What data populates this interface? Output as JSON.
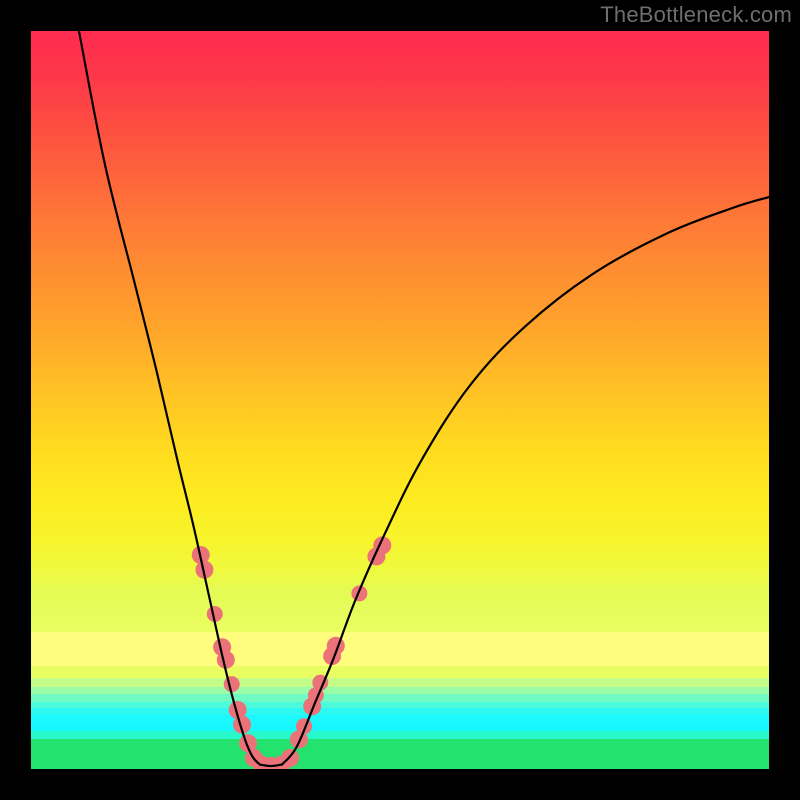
{
  "watermark": "TheBottleneck.com",
  "chart_data": {
    "type": "line",
    "title": "",
    "xlabel": "",
    "ylabel": "",
    "xlim": [
      0,
      100
    ],
    "ylim": [
      0,
      100
    ],
    "watermark": "TheBottleneck.com",
    "background_gradient": {
      "orientation": "vertical",
      "stops": [
        {
          "pos": 0,
          "color": "#fe2b4f"
        },
        {
          "pos": 50,
          "color": "#ffc724"
        },
        {
          "pos": 82,
          "color": "#fffd7d"
        },
        {
          "pos": 92,
          "color": "#1bf8fe"
        },
        {
          "pos": 100,
          "color": "#23e36e"
        }
      ]
    },
    "series": [
      {
        "name": "left-branch",
        "color": "#000000",
        "points": [
          {
            "x": 6.5,
            "y": 100
          },
          {
            "x": 10.0,
            "y": 82
          },
          {
            "x": 14.0,
            "y": 66
          },
          {
            "x": 17.0,
            "y": 54
          },
          {
            "x": 19.8,
            "y": 42
          },
          {
            "x": 22.0,
            "y": 33
          },
          {
            "x": 24.0,
            "y": 24
          },
          {
            "x": 26.0,
            "y": 15
          },
          {
            "x": 27.5,
            "y": 9
          },
          {
            "x": 29.0,
            "y": 4
          },
          {
            "x": 30.0,
            "y": 1.7
          },
          {
            "x": 31.0,
            "y": 0.6
          }
        ]
      },
      {
        "name": "right-branch",
        "color": "#000000",
        "points": [
          {
            "x": 34.0,
            "y": 0.6
          },
          {
            "x": 36.0,
            "y": 3
          },
          {
            "x": 38.5,
            "y": 9
          },
          {
            "x": 41.0,
            "y": 15
          },
          {
            "x": 44.0,
            "y": 23
          },
          {
            "x": 48.0,
            "y": 32
          },
          {
            "x": 53.0,
            "y": 42
          },
          {
            "x": 59.5,
            "y": 52
          },
          {
            "x": 67.0,
            "y": 60
          },
          {
            "x": 76.0,
            "y": 67
          },
          {
            "x": 86.0,
            "y": 72.5
          },
          {
            "x": 95.0,
            "y": 76
          },
          {
            "x": 100.0,
            "y": 77.5
          }
        ]
      },
      {
        "name": "valley-floor",
        "color": "#000000",
        "points": [
          {
            "x": 31.0,
            "y": 0.6
          },
          {
            "x": 32.5,
            "y": 0.4
          },
          {
            "x": 34.0,
            "y": 0.6
          }
        ]
      }
    ],
    "markers": {
      "color": "#ec7279",
      "radius_px": 9,
      "points": [
        {
          "x": 23.0,
          "y": 29.0,
          "r": 9
        },
        {
          "x": 23.5,
          "y": 27.0,
          "r": 9
        },
        {
          "x": 24.9,
          "y": 21.0,
          "r": 8
        },
        {
          "x": 25.9,
          "y": 16.5,
          "r": 9
        },
        {
          "x": 26.4,
          "y": 14.8,
          "r": 9
        },
        {
          "x": 27.2,
          "y": 11.5,
          "r": 8
        },
        {
          "x": 28.0,
          "y": 8.0,
          "r": 9
        },
        {
          "x": 28.6,
          "y": 6.0,
          "r": 9
        },
        {
          "x": 29.4,
          "y": 3.5,
          "r": 9
        },
        {
          "x": 30.2,
          "y": 1.5,
          "r": 9
        },
        {
          "x": 31.3,
          "y": 0.6,
          "r": 9
        },
        {
          "x": 32.6,
          "y": 0.4,
          "r": 9
        },
        {
          "x": 33.9,
          "y": 0.6,
          "r": 9
        },
        {
          "x": 35.1,
          "y": 1.5,
          "r": 9
        },
        {
          "x": 36.3,
          "y": 4.0,
          "r": 9
        },
        {
          "x": 37.0,
          "y": 5.8,
          "r": 8
        },
        {
          "x": 38.1,
          "y": 8.5,
          "r": 9
        },
        {
          "x": 38.6,
          "y": 10.0,
          "r": 8
        },
        {
          "x": 39.2,
          "y": 11.7,
          "r": 8
        },
        {
          "x": 40.8,
          "y": 15.3,
          "r": 9
        },
        {
          "x": 41.3,
          "y": 16.7,
          "r": 9
        },
        {
          "x": 44.5,
          "y": 23.8,
          "r": 8
        },
        {
          "x": 46.8,
          "y": 28.8,
          "r": 9
        },
        {
          "x": 47.6,
          "y": 30.3,
          "r": 9
        }
      ]
    }
  }
}
